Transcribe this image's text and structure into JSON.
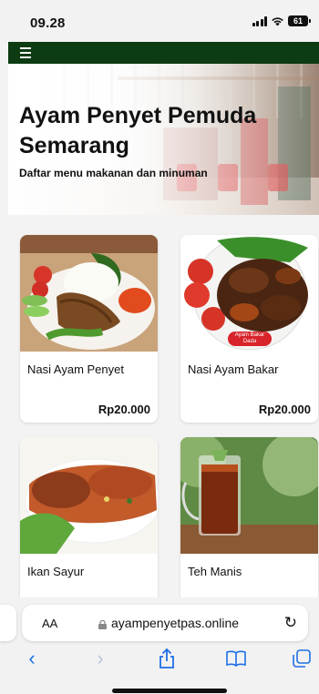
{
  "status_bar": {
    "time": "09.28",
    "battery": "61"
  },
  "hero": {
    "title": "Ayam Penyet Pemuda Semarang",
    "subtitle": "Daftar menu makanan dan minuman"
  },
  "menu": [
    {
      "name": "Nasi Ayam Penyet",
      "price": "Rp20.000"
    },
    {
      "name": "Nasi Ayam Bakar",
      "price": "Rp20.000",
      "image_label": "Ayam Bakar Dada"
    },
    {
      "name": "Ikan Sayur",
      "price": ""
    },
    {
      "name": "Teh Manis",
      "price": ""
    }
  ],
  "browser": {
    "text_size_label": "AA",
    "url": "ayampenyetpas.online",
    "reload_icon": "reload-icon",
    "toolbar": [
      "back-icon",
      "forward-icon",
      "share-icon",
      "bookmarks-icon",
      "tabs-icon"
    ]
  },
  "colors": {
    "topbar": "#0d3b12",
    "accent": "#1e6fe6"
  }
}
